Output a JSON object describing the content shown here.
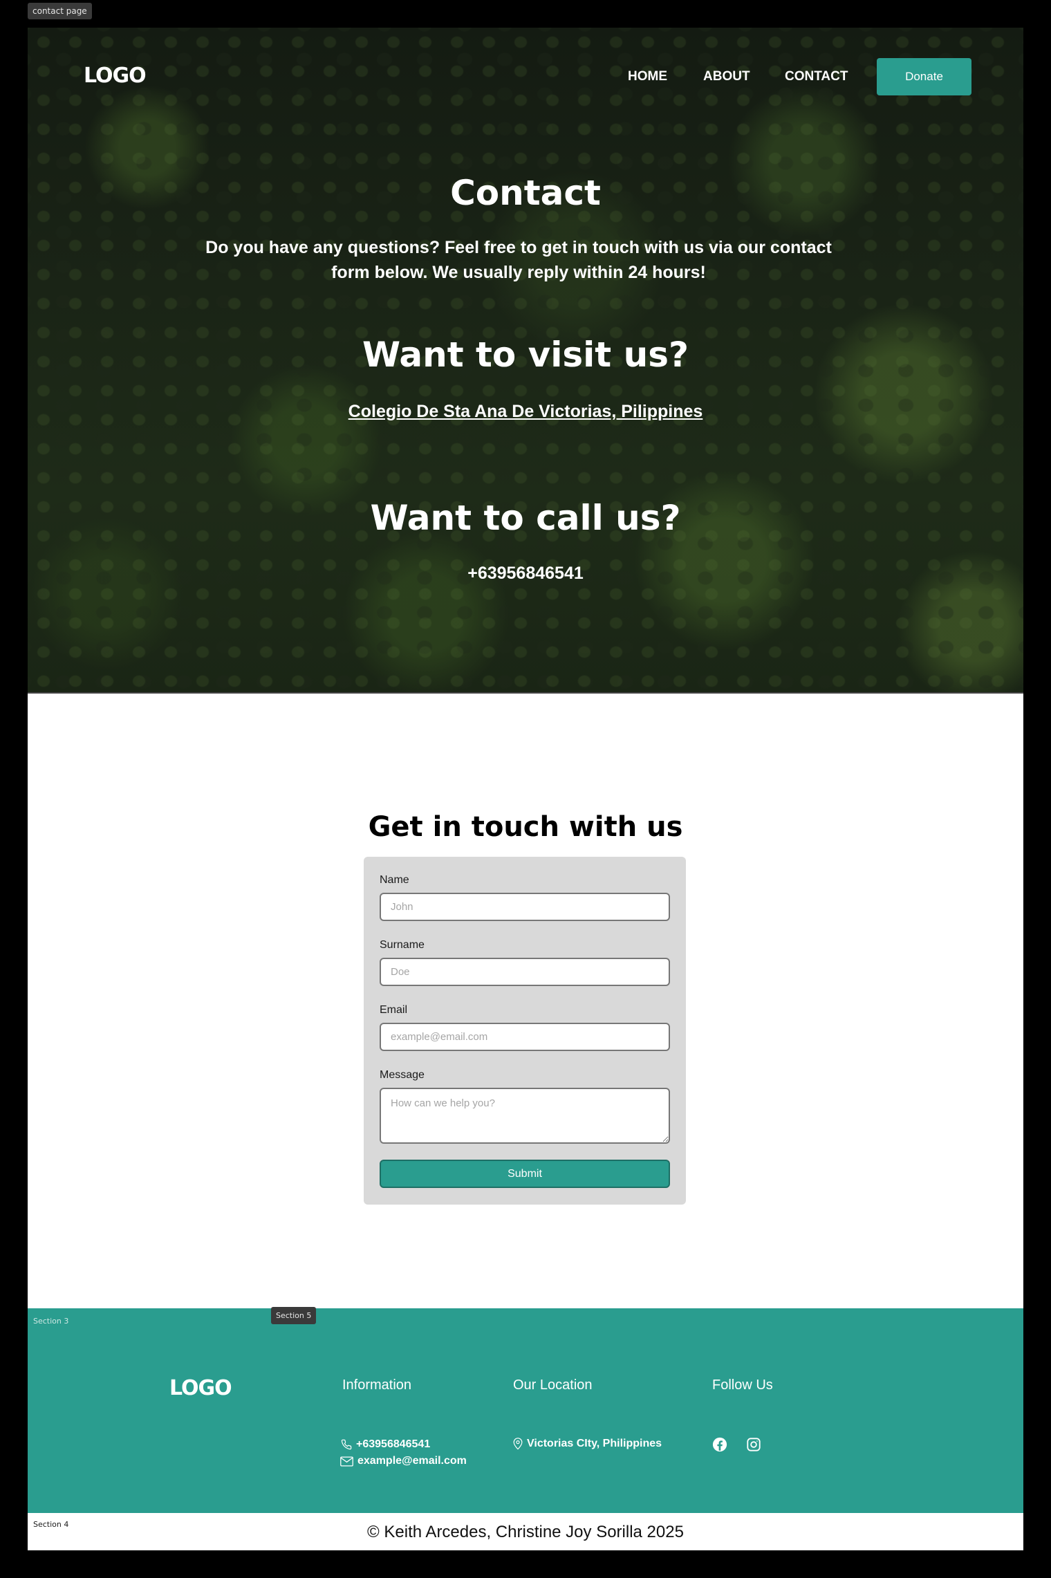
{
  "frame_label": "contact page",
  "nav": {
    "logo": "LOGO",
    "links": [
      "HOME",
      "ABOUT",
      "CONTACT"
    ],
    "donate": "Donate"
  },
  "hero": {
    "title": "Contact",
    "intro": "Do you have any questions? Feel free to get in touch with us via our contact form below. We usually reply within 24 hours!",
    "visit_title": "Want to visit us?",
    "address": "Colegio De Sta Ana De Victorias, Pilippines",
    "call_title": "Want to call us?",
    "phone": "+63956846541"
  },
  "form": {
    "title": "Get in  touch with us",
    "name_label": "Name",
    "name_placeholder": "John",
    "surname_label": "Surname",
    "surname_placeholder": "Doe",
    "email_label": "Email",
    "email_placeholder": "example@email.com",
    "message_label": "Message",
    "message_placeholder": "How can we help you?",
    "submit": "Submit"
  },
  "footer": {
    "section3_tag": "Section 3",
    "section5_tag": "Section 5",
    "logo": "LOGO",
    "info_title": "Information",
    "phone": "+63956846541",
    "email": "example@email.com",
    "location_title": "Our Location",
    "location": "Victorias CIty, Philippines",
    "follow_title": "Follow Us",
    "social_icons": [
      "facebook-icon",
      "instagram-icon"
    ]
  },
  "bottom": {
    "section4_tag": "Section 4",
    "copyright": "© Keith Arcedes, Christine Joy Sorilla 2025"
  },
  "colors": {
    "accent": "#2a9d8f",
    "hero_dark": "#1a2416"
  }
}
